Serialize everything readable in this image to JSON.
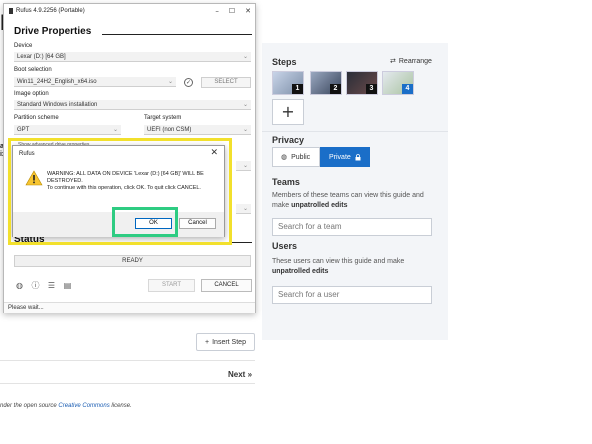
{
  "background": {
    "title_fragment": "M",
    "side_fragments": [
      "ar",
      "ix"
    ],
    "steps": {
      "heading": "Steps",
      "rearrange_label": "Rearrange",
      "thumbnails": [
        "1",
        "2",
        "3",
        "4"
      ],
      "add_label": "+"
    },
    "privacy": {
      "heading": "Privacy",
      "public_label": "Public",
      "private_label": "Private",
      "selected": "Private"
    },
    "teams": {
      "heading": "Teams",
      "desc_prefix": "Members of these teams can view this guide and make ",
      "desc_bold": "unpatrolled edits",
      "search_placeholder": "Search for a team"
    },
    "users": {
      "heading": "Users",
      "desc_prefix": "These users can view this guide and make ",
      "desc_bold": "unpatrolled edits",
      "search_placeholder": "Search for a user"
    },
    "insert_step_label": "Insert Step",
    "next_label": "Next »",
    "footer_prefix": "nder the open source ",
    "footer_link": "Creative Commons",
    "footer_suffix": " license."
  },
  "rufus": {
    "window_title": "Rufus 4.9.2256 (Portable)",
    "drive_properties_heading": "Drive Properties",
    "device_label": "Device",
    "device_value": "Lexar (D:) [64 GB]",
    "boot_selection_label": "Boot selection",
    "boot_selection_value": "Win11_24H2_English_x64.iso",
    "select_button": "SELECT",
    "image_option_label": "Image option",
    "image_option_value": "Standard Windows installation",
    "partition_scheme_label": "Partition scheme",
    "partition_scheme_value": "GPT",
    "target_system_label": "Target system",
    "target_system_value": "UEFI (non CSM)",
    "partial_text": "Show advanced drive properties",
    "status_heading": "Status",
    "status_value": "READY",
    "start_button": "START",
    "cancel_button": "CANCEL",
    "statusbar_text": "Please wait..."
  },
  "dialog": {
    "title": "Rufus",
    "message_line1": "WARNING: ALL DATA ON DEVICE 'Lexar (D:) [64 GB]' WILL BE DESTROYED.",
    "message_line2": "To continue with this operation, click OK. To quit click CANCEL.",
    "ok_button": "OK",
    "cancel_button": "Cancel"
  },
  "colors": {
    "highlight_yellow": "#f2e02c",
    "highlight_green": "#2ecc82",
    "accent_blue": "#1a6ec8"
  }
}
